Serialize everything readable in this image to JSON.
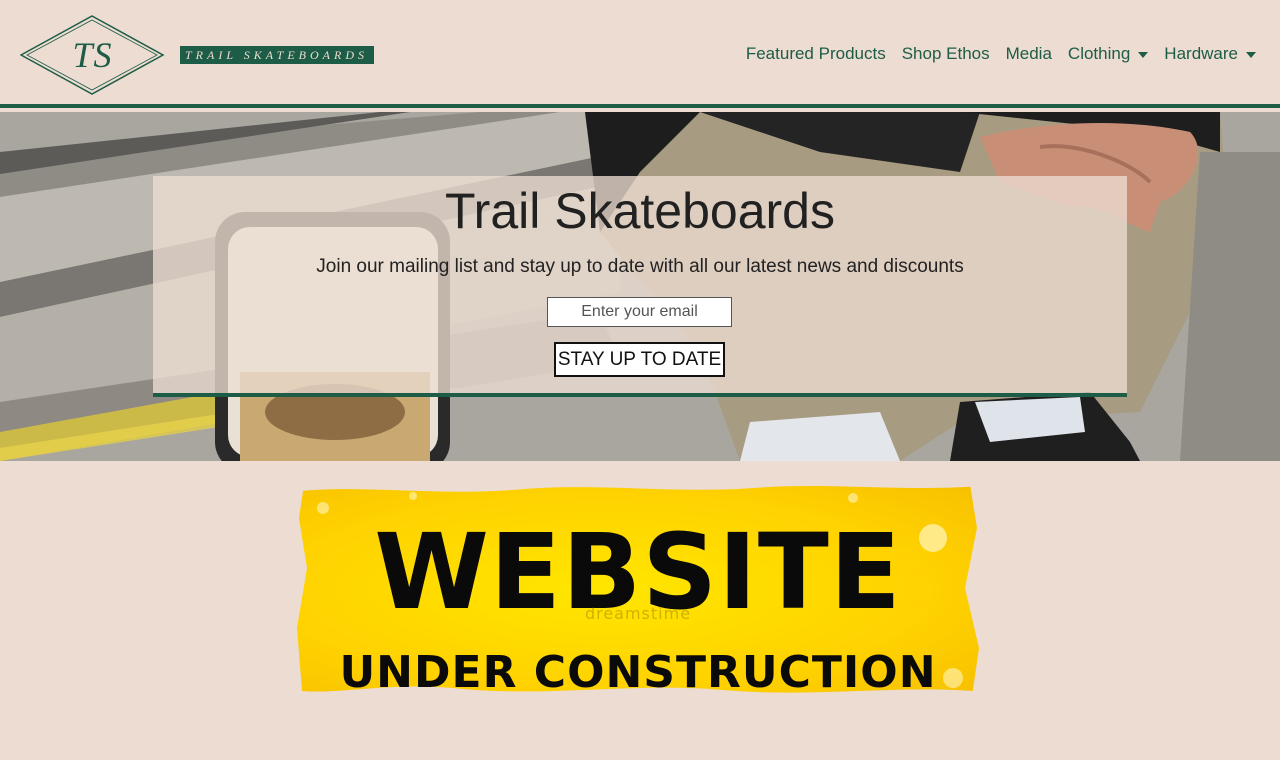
{
  "brand": {
    "monogram": "TS",
    "tagline": "TRAIL SKATEBOARDS",
    "color": "#1d5c46"
  },
  "nav": {
    "items": [
      {
        "label": "Featured Products",
        "dropdown": false
      },
      {
        "label": "Shop Ethos",
        "dropdown": false
      },
      {
        "label": "Media",
        "dropdown": false
      },
      {
        "label": "Clothing",
        "dropdown": true
      },
      {
        "label": "Hardware",
        "dropdown": true
      }
    ]
  },
  "hero": {
    "title": "Trail Skateboards",
    "subtitle": "Join our mailing list and stay up to date with all our latest news and discounts",
    "email_placeholder": "Enter your email",
    "button_label": "STAY UP TO DATE"
  },
  "construction": {
    "line1": "WEBSITE",
    "line2": "UNDER CONSTRUCTION",
    "watermark": "dreamstime"
  },
  "colors": {
    "background": "#ecdcd1",
    "accent": "#1d5c46",
    "banner_yellow": "#ffd200"
  }
}
